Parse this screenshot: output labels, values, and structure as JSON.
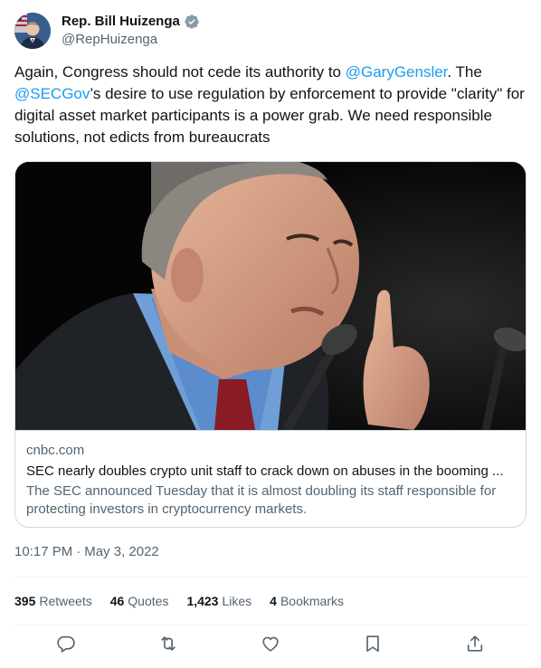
{
  "author": {
    "display_name": "Rep. Bill Huizenga",
    "handle": "@RepHuizenga",
    "verified_icon": "verified-badge-icon",
    "avatar_colors": {
      "bg": "#2b4c7e",
      "suit": "#1e2b45"
    }
  },
  "tweet": {
    "segments": [
      {
        "type": "text",
        "value": "Again, Congress should not cede its authority to "
      },
      {
        "type": "mention",
        "value": "@GaryGensler"
      },
      {
        "type": "text",
        "value": ". The "
      },
      {
        "type": "mention",
        "value": "@SECGov"
      },
      {
        "type": "text",
        "value": "’s desire to use regulation by enforcement to provide \"clarity\" for digital asset market participants is a power grab. We need responsible solutions, not edicts from bureaucrats"
      }
    ],
    "mention_color": "#1d9bf0"
  },
  "card": {
    "domain": "cnbc.com",
    "title": "SEC nearly doubles crypto unit staff to crack down on abuses in the booming ...",
    "description": "The SEC announced Tuesday that it is almost doubling its staff responsible for protecting investors in cryptocurrency markets."
  },
  "timestamp": {
    "time": "10:17 PM",
    "separator": "·",
    "date": "May 3, 2022"
  },
  "stats": [
    {
      "value": "395",
      "label": "Retweets"
    },
    {
      "value": "46",
      "label": "Quotes"
    },
    {
      "value": "1,423",
      "label": "Likes"
    },
    {
      "value": "4",
      "label": "Bookmarks"
    }
  ],
  "actions": [
    {
      "name": "reply",
      "icon": "reply-icon"
    },
    {
      "name": "retweet",
      "icon": "retweet-icon"
    },
    {
      "name": "like",
      "icon": "heart-icon"
    },
    {
      "name": "bookmark",
      "icon": "bookmark-icon"
    },
    {
      "name": "share",
      "icon": "share-icon"
    }
  ]
}
